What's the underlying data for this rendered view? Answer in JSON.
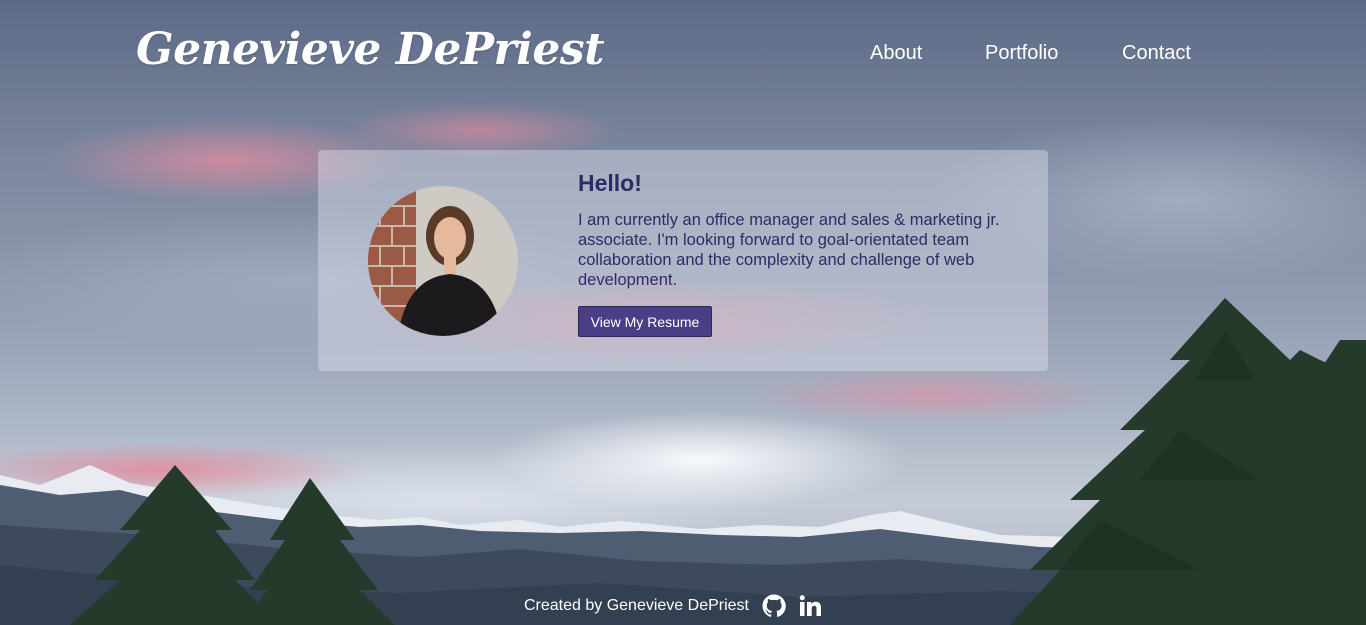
{
  "header": {
    "site_title": "Genevieve DePriest",
    "nav": {
      "about": "About",
      "portfolio": "Portfolio",
      "contact": "Contact"
    }
  },
  "intro": {
    "greeting": "Hello!",
    "bio": "I am currently an office manager and sales & marketing jr. associate. I'm looking forward to goal-orientated team collaboration and the complexity and challenge of web development.",
    "resume_button": "View My Resume"
  },
  "footer": {
    "credit": "Created by Genevieve DePriest",
    "icons": [
      "github-icon",
      "linkedin-icon"
    ]
  },
  "colors": {
    "accent_text": "#2f2a66",
    "button_bg": "#4a3f86"
  }
}
